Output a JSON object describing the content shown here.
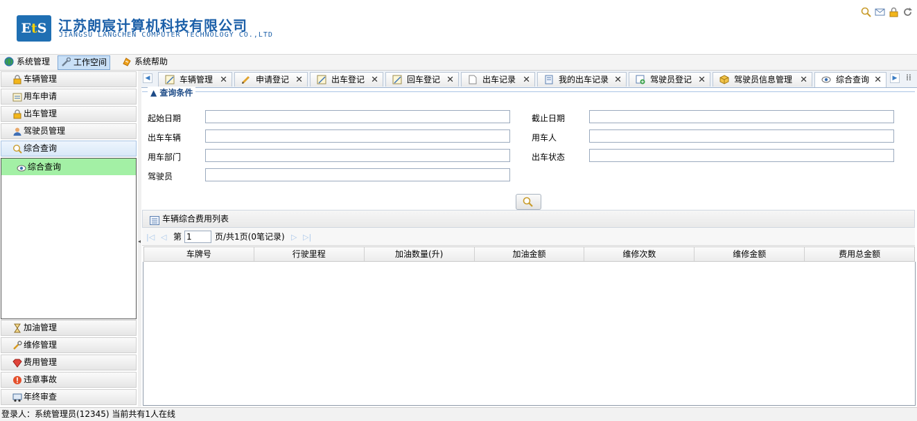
{
  "header": {
    "logo_text": "EtS",
    "company_cn": "江苏朗宸计算机科技有限公司",
    "company_en": "JIANGSU LANGCHEN COMPUTER TECHNOLOGY CO.,LTD",
    "icons": [
      "search-icon",
      "mail-icon",
      "lock-icon",
      "refresh-icon"
    ]
  },
  "menubar": {
    "items": [
      {
        "label": "系统管理",
        "icon": "globe-icon"
      },
      {
        "label": "工作空间",
        "icon": "wrench-icon"
      },
      {
        "label": "系统帮助",
        "icon": "help-icon"
      }
    ]
  },
  "sidebar": {
    "sections": [
      {
        "label": "车辆管理",
        "icon": "lock-icon"
      },
      {
        "label": "用车申请",
        "icon": "form-icon"
      },
      {
        "label": "出车管理",
        "icon": "lock-icon"
      },
      {
        "label": "驾驶员管理",
        "icon": "user-icon"
      },
      {
        "label": "综合查询",
        "icon": "search-icon"
      }
    ],
    "open_sub_item": {
      "label": "综合查询",
      "icon": "eye-icon"
    },
    "bottom_sections": [
      {
        "label": "加油管理",
        "icon": "hourglass-icon"
      },
      {
        "label": "维修管理",
        "icon": "wrench-icon"
      },
      {
        "label": "费用管理",
        "icon": "gem-icon"
      },
      {
        "label": "违章事故",
        "icon": "warning-icon"
      },
      {
        "label": "年终审查",
        "icon": "car-icon"
      }
    ]
  },
  "tabs": [
    {
      "label": "车辆管理",
      "icon": "note-icon"
    },
    {
      "label": "申请登记",
      "icon": "pencil-icon"
    },
    {
      "label": "出车登记",
      "icon": "note-icon"
    },
    {
      "label": "回车登记",
      "icon": "note-icon"
    },
    {
      "label": "出车记录",
      "icon": "page-icon"
    },
    {
      "label": "我的出车记录",
      "icon": "book-icon"
    },
    {
      "label": "驾驶员登记",
      "icon": "add-icon"
    },
    {
      "label": "驾驶员信息管理",
      "icon": "box-icon"
    },
    {
      "label": "综合查询",
      "icon": "eye-icon"
    }
  ],
  "query": {
    "legend": "查询条件",
    "fields": {
      "start_date": {
        "label": "起始日期",
        "value": ""
      },
      "end_date": {
        "label": "截止日期",
        "value": ""
      },
      "vehicle": {
        "label": "出车车辆",
        "value": ""
      },
      "user": {
        "label": "用车人",
        "value": ""
      },
      "department": {
        "label": "用车部门",
        "value": ""
      },
      "status": {
        "label": "出车状态",
        "value": ""
      },
      "driver": {
        "label": "驾驶员",
        "value": ""
      }
    }
  },
  "grid": {
    "title": "车辆综合费用列表",
    "pager": {
      "page_prefix": "第",
      "page_value": "1",
      "page_suffix": "页/共1页(0笔记录)"
    },
    "columns": [
      "车牌号",
      "行驶里程",
      "加油数量(升)",
      "加油金额",
      "维修次数",
      "维修金额",
      "费用总金额"
    ],
    "rows": []
  },
  "status": {
    "text": "登录人：系统管理员(12345)  当前共有1人在线"
  }
}
